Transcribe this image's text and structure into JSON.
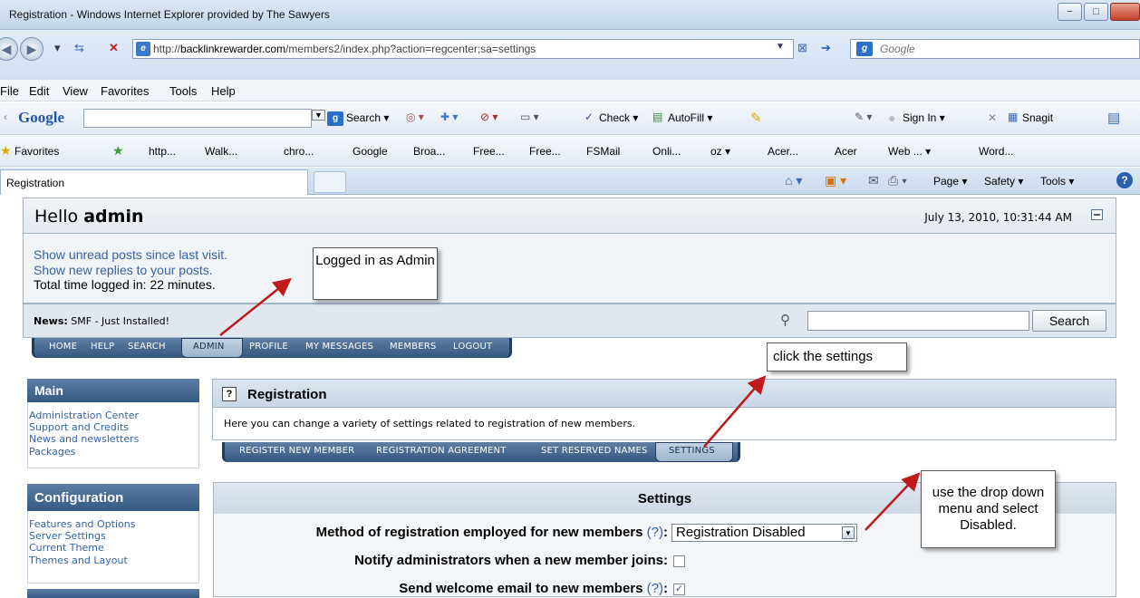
{
  "window": {
    "title": "Registration - Windows Internet Explorer provided by The Sawyers",
    "minimize": "−",
    "maximize": "□"
  },
  "address": {
    "url_prefix": "http://",
    "url_domain": "backlinkrewarder.com",
    "url_path": "/members2/index.php?action=regcenter;sa=settings",
    "search_placeholder": "Google"
  },
  "menu": [
    "File",
    "Edit",
    "View",
    "Favorites",
    "Tools",
    "Help"
  ],
  "google_toolbar": {
    "logo": "Google",
    "search": "Search ▾",
    "check": "Check ▾",
    "autofill": "AutoFill ▾",
    "sign_in": "Sign In ▾",
    "snagit": "Snagit"
  },
  "favorites_bar": {
    "favorites": "Favorites",
    "items": [
      "http...",
      "Walk...",
      "chro...",
      "Google",
      "Broa...",
      "Free...",
      "Free...",
      "FSMail",
      "Onli...",
      "oz ▾",
      "Acer...",
      "Acer",
      "Web ... ▾",
      "Word..."
    ]
  },
  "tabs": {
    "active": "Registration",
    "page": "Page ▾",
    "safety": "Safety ▾",
    "tools": "Tools ▾"
  },
  "forum": {
    "hello_prefix": "Hello",
    "user": "admin",
    "datetime": "July 13, 2010, 10:31:44 AM",
    "unread_link": "Show unread posts since last visit.",
    "replies_link": "Show new replies to your posts.",
    "time_logged": "Total time logged in: 22 minutes.",
    "news_label": "News:",
    "news_text": "SMF - Just Installed!",
    "search_button": "Search",
    "nav": [
      "HOME",
      "HELP",
      "SEARCH",
      "ADMIN",
      "PROFILE",
      "MY MESSAGES",
      "MEMBERS",
      "LOGOUT"
    ]
  },
  "sidebar": {
    "main_title": "Main",
    "main_links": [
      "Administration Center",
      "Support and Credits",
      "News and newsletters",
      "Packages"
    ],
    "config_title": "Configuration",
    "config_links": [
      "Features and Options",
      "Server Settings",
      "Current Theme",
      "Themes and Layout"
    ]
  },
  "registration": {
    "title": "Registration",
    "description": "Here you can change a variety of settings related to registration of new members.",
    "tabs": [
      "REGISTER NEW MEMBER",
      "REGISTRATION AGREEMENT",
      "SET RESERVED NAMES",
      "SETTINGS"
    ]
  },
  "settings": {
    "title": "Settings",
    "method_label": "Method of registration employed for new members",
    "method_help": "(?)",
    "method_value": "Registration Disabled",
    "notify_label": "Notify administrators when a new member joins:",
    "notify_checked": false,
    "welcome_label": "Send welcome email to new members",
    "welcome_help": "(?)",
    "welcome_checked": true
  },
  "callouts": {
    "logged_in": "Logged in as Admin",
    "click_settings": "click the settings",
    "dropdown": "use the drop down menu and select Disabled."
  },
  "colors": {
    "link": "#3463a4",
    "nav_bar": "#34577f",
    "arrow": "#c0191b"
  }
}
